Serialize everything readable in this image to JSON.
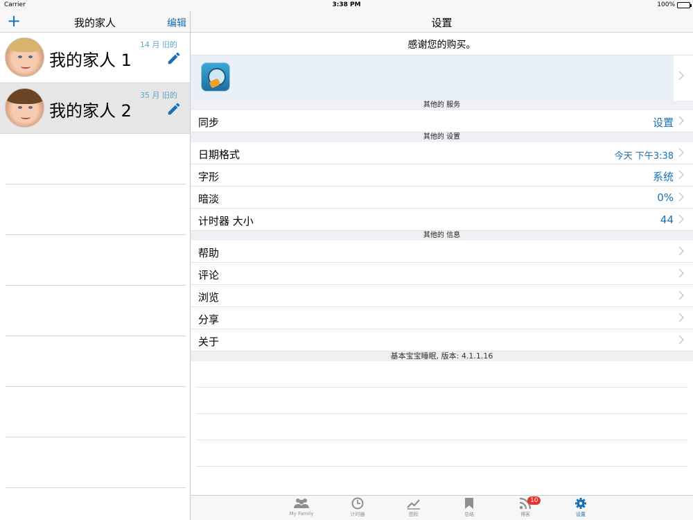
{
  "status_bar": {
    "carrier": "Carrier",
    "time": "3:38 PM",
    "battery": "100%"
  },
  "left": {
    "add_label": "+",
    "title": "我的家人",
    "edit_label": "编辑",
    "people": [
      {
        "name": "我的家人 1",
        "age": "14 月 旧的"
      },
      {
        "name": "我的家人 2",
        "age": "35 月 旧的"
      }
    ]
  },
  "right": {
    "title": "设置",
    "thanks": "感谢您的购买。",
    "sections": {
      "services": "其他的 服务",
      "settings": "其他的 设置",
      "info": "其他的 信息"
    },
    "sync": {
      "label": "同步",
      "value": "设置"
    },
    "date_format": {
      "label": "日期格式",
      "value": "今天 下午3:38"
    },
    "font": {
      "label": "字形",
      "value": "系统"
    },
    "dim": {
      "label": "暗淡",
      "value": "0%"
    },
    "timer_size": {
      "label": "计时器 大小",
      "value": "44"
    },
    "info_items": [
      "帮助",
      "评论",
      "浏览",
      "分享",
      "关于"
    ],
    "version": "基本宝宝睡眠, 版本: 4.1.1.16"
  },
  "tabs": [
    {
      "label": "My Family",
      "icon": "family-icon"
    },
    {
      "label": "计时器",
      "icon": "clock-icon"
    },
    {
      "label": "图标",
      "icon": "chart-icon"
    },
    {
      "label": "总结",
      "icon": "bookmark-icon"
    },
    {
      "label": "博客",
      "icon": "rss-icon",
      "badge": "10"
    },
    {
      "label": "设置",
      "icon": "gear-icon",
      "active": true
    }
  ],
  "colors": {
    "accent": "#1a6fb5",
    "badge": "#e8322c"
  }
}
